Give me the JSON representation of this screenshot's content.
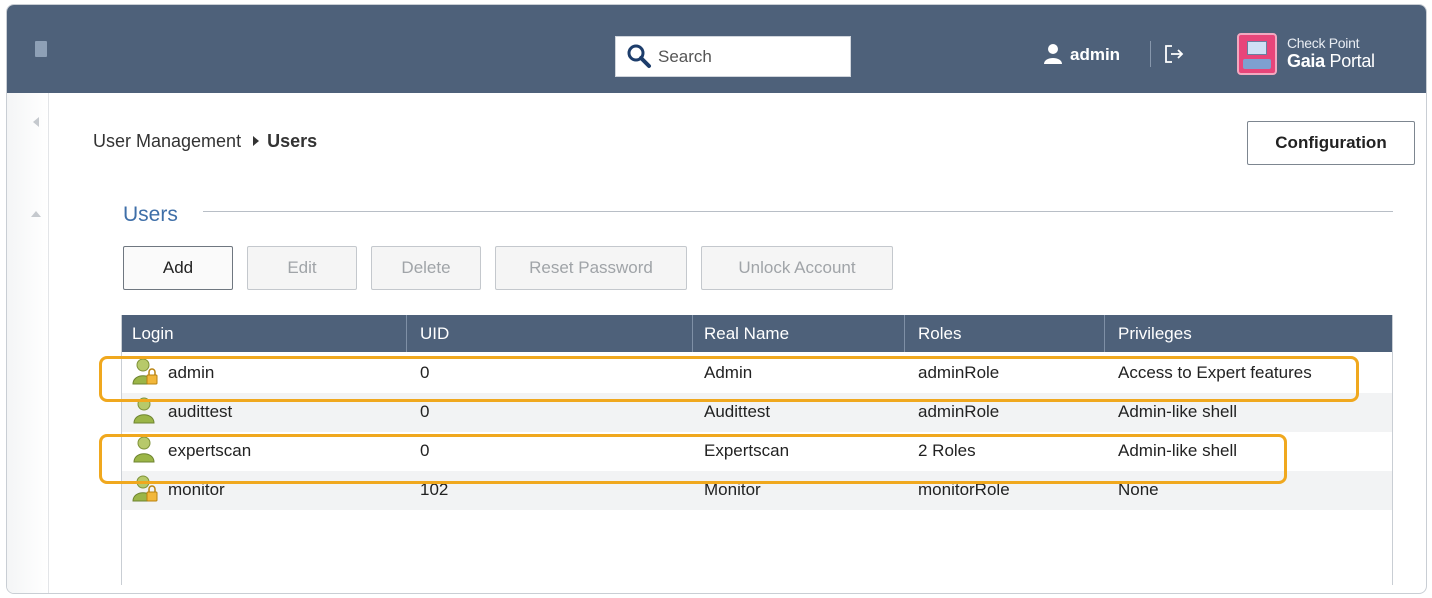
{
  "header": {
    "search_placeholder": "Search",
    "user_name": "admin",
    "logo_line1": "Check Point",
    "logo_line2_bold": "Gaia",
    "logo_line2_rest": " Portal"
  },
  "breadcrumb": {
    "parent": "User Management",
    "current": "Users"
  },
  "configuration_label": "Configuration",
  "section": {
    "title": "Users"
  },
  "toolbar": {
    "add": "Add",
    "edit": "Edit",
    "delete": "Delete",
    "reset_password": "Reset Password",
    "unlock_account": "Unlock Account"
  },
  "table": {
    "columns": [
      "Login",
      "UID",
      "Real Name",
      "Roles",
      "Privileges"
    ],
    "rows": [
      {
        "login": "admin",
        "uid": "0",
        "real_name": "Admin",
        "roles": "adminRole",
        "privileges": "Access to Expert features",
        "icon": "user-lock-icon"
      },
      {
        "login": "audittest",
        "uid": "0",
        "real_name": "Audittest",
        "roles": "adminRole",
        "privileges": "Admin-like shell",
        "icon": "user-icon"
      },
      {
        "login": "expertscan",
        "uid": "0",
        "real_name": "Expertscan",
        "roles": "2 Roles",
        "privileges": "Admin-like shell",
        "icon": "user-icon"
      },
      {
        "login": "monitor",
        "uid": "102",
        "real_name": "Monitor",
        "roles": "monitorRole",
        "privileges": "None",
        "icon": "user-lock-icon"
      }
    ]
  },
  "colors": {
    "header_bg": "#4e617a",
    "highlight": "#f0a81e",
    "section_title": "#3f6fa8"
  }
}
